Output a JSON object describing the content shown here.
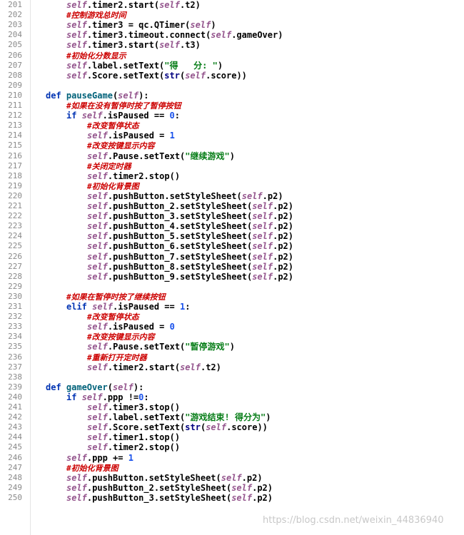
{
  "editor": {
    "watermark": "https://blog.csdn.net/weixin_44836940",
    "lines": [
      {
        "n": "201",
        "indent": 2,
        "tokens": [
          [
            "self",
            "self"
          ],
          [
            "pl",
            ".timer2.start("
          ],
          [
            "self",
            "self"
          ],
          [
            "pl",
            ".t2)"
          ]
        ]
      },
      {
        "n": "202",
        "indent": 2,
        "tokens": [
          [
            "cm",
            "#控制游戏总时间"
          ]
        ]
      },
      {
        "n": "203",
        "indent": 2,
        "tokens": [
          [
            "self",
            "self"
          ],
          [
            "pl",
            ".timer3 = qc.QTimer("
          ],
          [
            "self",
            "self"
          ],
          [
            "pl",
            ")"
          ]
        ]
      },
      {
        "n": "204",
        "indent": 2,
        "tokens": [
          [
            "self",
            "self"
          ],
          [
            "pl",
            ".timer3.timeout.connect("
          ],
          [
            "self",
            "self"
          ],
          [
            "pl",
            ".gameOver)"
          ]
        ]
      },
      {
        "n": "205",
        "indent": 2,
        "tokens": [
          [
            "self",
            "self"
          ],
          [
            "pl",
            ".timer3.start("
          ],
          [
            "self",
            "self"
          ],
          [
            "pl",
            ".t3)"
          ]
        ]
      },
      {
        "n": "206",
        "indent": 2,
        "tokens": [
          [
            "cm",
            "#初始化分数显示"
          ]
        ]
      },
      {
        "n": "207",
        "indent": 2,
        "tokens": [
          [
            "self",
            "self"
          ],
          [
            "pl",
            ".label.setText("
          ],
          [
            "str",
            "\"得   分: \""
          ],
          [
            "pl",
            ")"
          ]
        ]
      },
      {
        "n": "208",
        "indent": 2,
        "tokens": [
          [
            "self",
            "self"
          ],
          [
            "pl",
            ".Score.setText("
          ],
          [
            "bi",
            "str"
          ],
          [
            "pl",
            "("
          ],
          [
            "self",
            "self"
          ],
          [
            "pl",
            ".score))"
          ]
        ]
      },
      {
        "n": "209",
        "indent": 0,
        "tokens": []
      },
      {
        "n": "210",
        "indent": 1,
        "tokens": [
          [
            "kw",
            "def "
          ],
          [
            "fn",
            "pauseGame"
          ],
          [
            "pl",
            "("
          ],
          [
            "self",
            "self"
          ],
          [
            "pl",
            "):"
          ]
        ]
      },
      {
        "n": "211",
        "indent": 2,
        "tokens": [
          [
            "cm",
            "#如果在没有暂停时按了暂停按钮"
          ]
        ]
      },
      {
        "n": "212",
        "indent": 2,
        "tokens": [
          [
            "kw",
            "if "
          ],
          [
            "self",
            "self"
          ],
          [
            "pl",
            ".isPaused == "
          ],
          [
            "num",
            "0"
          ],
          [
            "pl",
            ":"
          ]
        ]
      },
      {
        "n": "213",
        "indent": 3,
        "tokens": [
          [
            "cm",
            "#改变暂停状态"
          ]
        ]
      },
      {
        "n": "214",
        "indent": 3,
        "tokens": [
          [
            "self",
            "self"
          ],
          [
            "pl",
            ".isPaused = "
          ],
          [
            "num",
            "1"
          ]
        ]
      },
      {
        "n": "215",
        "indent": 3,
        "tokens": [
          [
            "cm",
            "#改变按键显示内容"
          ]
        ]
      },
      {
        "n": "216",
        "indent": 3,
        "tokens": [
          [
            "self",
            "self"
          ],
          [
            "pl",
            ".Pause.setText("
          ],
          [
            "str",
            "\"继续游戏\""
          ],
          [
            "pl",
            ")"
          ]
        ]
      },
      {
        "n": "217",
        "indent": 3,
        "tokens": [
          [
            "cm",
            "#关闭定时器"
          ]
        ]
      },
      {
        "n": "218",
        "indent": 3,
        "tokens": [
          [
            "self",
            "self"
          ],
          [
            "pl",
            ".timer2.stop()"
          ]
        ]
      },
      {
        "n": "219",
        "indent": 3,
        "tokens": [
          [
            "cm",
            "#初始化背景图"
          ]
        ]
      },
      {
        "n": "220",
        "indent": 3,
        "tokens": [
          [
            "self",
            "self"
          ],
          [
            "pl",
            ".pushButton.setStyleSheet("
          ],
          [
            "self",
            "self"
          ],
          [
            "pl",
            ".p2)"
          ]
        ]
      },
      {
        "n": "221",
        "indent": 3,
        "tokens": [
          [
            "self",
            "self"
          ],
          [
            "pl",
            ".pushButton_2.setStyleSheet("
          ],
          [
            "self",
            "self"
          ],
          [
            "pl",
            ".p2)"
          ]
        ]
      },
      {
        "n": "222",
        "indent": 3,
        "tokens": [
          [
            "self",
            "self"
          ],
          [
            "pl",
            ".pushButton_3.setStyleSheet("
          ],
          [
            "self",
            "self"
          ],
          [
            "pl",
            ".p2)"
          ]
        ]
      },
      {
        "n": "223",
        "indent": 3,
        "tokens": [
          [
            "self",
            "self"
          ],
          [
            "pl",
            ".pushButton_4.setStyleSheet("
          ],
          [
            "self",
            "self"
          ],
          [
            "pl",
            ".p2)"
          ]
        ]
      },
      {
        "n": "224",
        "indent": 3,
        "tokens": [
          [
            "self",
            "self"
          ],
          [
            "pl",
            ".pushButton_5.setStyleSheet("
          ],
          [
            "self",
            "self"
          ],
          [
            "pl",
            ".p2)"
          ]
        ]
      },
      {
        "n": "225",
        "indent": 3,
        "tokens": [
          [
            "self",
            "self"
          ],
          [
            "pl",
            ".pushButton_6.setStyleSheet("
          ],
          [
            "self",
            "self"
          ],
          [
            "pl",
            ".p2)"
          ]
        ]
      },
      {
        "n": "226",
        "indent": 3,
        "tokens": [
          [
            "self",
            "self"
          ],
          [
            "pl",
            ".pushButton_7.setStyleSheet("
          ],
          [
            "self",
            "self"
          ],
          [
            "pl",
            ".p2)"
          ]
        ]
      },
      {
        "n": "227",
        "indent": 3,
        "tokens": [
          [
            "self",
            "self"
          ],
          [
            "pl",
            ".pushButton_8.setStyleSheet("
          ],
          [
            "self",
            "self"
          ],
          [
            "pl",
            ".p2)"
          ]
        ]
      },
      {
        "n": "228",
        "indent": 3,
        "tokens": [
          [
            "self",
            "self"
          ],
          [
            "pl",
            ".pushButton_9.setStyleSheet("
          ],
          [
            "self",
            "self"
          ],
          [
            "pl",
            ".p2)"
          ]
        ]
      },
      {
        "n": "229",
        "indent": 0,
        "tokens": []
      },
      {
        "n": "230",
        "indent": 2,
        "tokens": [
          [
            "cm",
            "#如果在暂停时按了继续按钮"
          ]
        ]
      },
      {
        "n": "231",
        "indent": 2,
        "tokens": [
          [
            "kw",
            "elif "
          ],
          [
            "self",
            "self"
          ],
          [
            "pl",
            ".isPaused == "
          ],
          [
            "num",
            "1"
          ],
          [
            "pl",
            ":"
          ]
        ]
      },
      {
        "n": "232",
        "indent": 3,
        "tokens": [
          [
            "cm",
            "#改变暂停状态"
          ]
        ]
      },
      {
        "n": "233",
        "indent": 3,
        "tokens": [
          [
            "self",
            "self"
          ],
          [
            "pl",
            ".isPaused = "
          ],
          [
            "num",
            "0"
          ]
        ]
      },
      {
        "n": "234",
        "indent": 3,
        "tokens": [
          [
            "cm",
            "#改变按键显示内容"
          ]
        ]
      },
      {
        "n": "235",
        "indent": 3,
        "tokens": [
          [
            "self",
            "self"
          ],
          [
            "pl",
            ".Pause.setText("
          ],
          [
            "str",
            "\"暂停游戏\""
          ],
          [
            "pl",
            ")"
          ]
        ]
      },
      {
        "n": "236",
        "indent": 3,
        "tokens": [
          [
            "cm",
            "#重新打开定时器"
          ]
        ]
      },
      {
        "n": "237",
        "indent": 3,
        "tokens": [
          [
            "self",
            "self"
          ],
          [
            "pl",
            ".timer2.start("
          ],
          [
            "self",
            "self"
          ],
          [
            "pl",
            ".t2)"
          ]
        ]
      },
      {
        "n": "238",
        "indent": 0,
        "tokens": []
      },
      {
        "n": "239",
        "indent": 1,
        "tokens": [
          [
            "kw",
            "def "
          ],
          [
            "fn",
            "gameOver"
          ],
          [
            "pl",
            "("
          ],
          [
            "self",
            "self"
          ],
          [
            "pl",
            "):"
          ]
        ]
      },
      {
        "n": "240",
        "indent": 2,
        "tokens": [
          [
            "kw",
            "if "
          ],
          [
            "self",
            "self"
          ],
          [
            "pl",
            ".ppp !="
          ],
          [
            "num",
            "0"
          ],
          [
            "pl",
            ":"
          ]
        ]
      },
      {
        "n": "241",
        "indent": 3,
        "tokens": [
          [
            "self",
            "self"
          ],
          [
            "pl",
            ".timer3.stop()"
          ]
        ]
      },
      {
        "n": "242",
        "indent": 3,
        "tokens": [
          [
            "self",
            "self"
          ],
          [
            "pl",
            ".label.setText("
          ],
          [
            "str",
            "\"游戏结束! 得分为\""
          ],
          [
            "pl",
            ")"
          ]
        ]
      },
      {
        "n": "243",
        "indent": 3,
        "tokens": [
          [
            "self",
            "self"
          ],
          [
            "pl",
            ".Score.setText("
          ],
          [
            "bi",
            "str"
          ],
          [
            "pl",
            "("
          ],
          [
            "self",
            "self"
          ],
          [
            "pl",
            ".score))"
          ]
        ]
      },
      {
        "n": "244",
        "indent": 3,
        "tokens": [
          [
            "self",
            "self"
          ],
          [
            "pl",
            ".timer1.stop()"
          ]
        ]
      },
      {
        "n": "245",
        "indent": 3,
        "tokens": [
          [
            "self",
            "self"
          ],
          [
            "pl",
            ".timer2.stop()"
          ]
        ]
      },
      {
        "n": "246",
        "indent": 2,
        "tokens": [
          [
            "self",
            "self"
          ],
          [
            "pl",
            ".ppp += "
          ],
          [
            "num",
            "1"
          ]
        ]
      },
      {
        "n": "247",
        "indent": 2,
        "tokens": [
          [
            "cm",
            "#初始化背景图"
          ]
        ]
      },
      {
        "n": "248",
        "indent": 2,
        "tokens": [
          [
            "self",
            "self"
          ],
          [
            "pl",
            ".pushButton.setStyleSheet("
          ],
          [
            "self",
            "self"
          ],
          [
            "pl",
            ".p2)"
          ]
        ]
      },
      {
        "n": "249",
        "indent": 2,
        "tokens": [
          [
            "self",
            "self"
          ],
          [
            "pl",
            ".pushButton_2.setStyleSheet("
          ],
          [
            "self",
            "self"
          ],
          [
            "pl",
            ".p2)"
          ]
        ]
      },
      {
        "n": "250",
        "indent": 2,
        "tokens": [
          [
            "self",
            "self"
          ],
          [
            "pl",
            ".pushButton_3.setStyleSheet("
          ],
          [
            "self",
            "self"
          ],
          [
            "pl",
            ".p2)"
          ]
        ]
      }
    ]
  }
}
